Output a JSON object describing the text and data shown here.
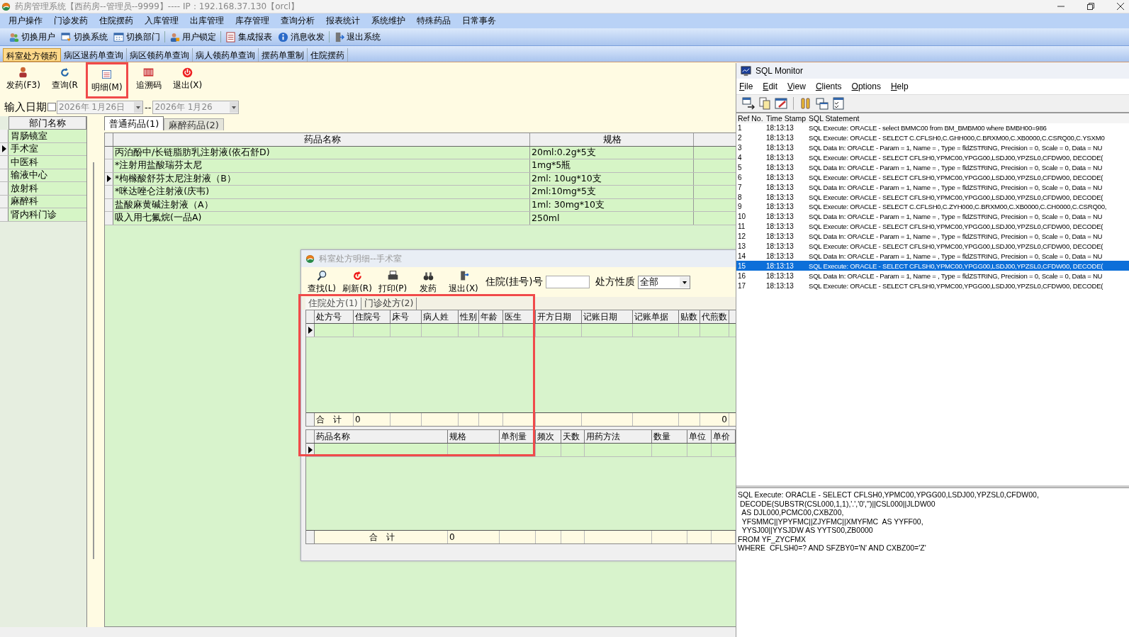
{
  "main_window": {
    "title": "药房管理系统【西药房--管理员--9999】---- IP：192.168.37.130【orcl】",
    "menu": [
      "用户操作",
      "门诊发药",
      "住院摆药",
      "入库管理",
      "出库管理",
      "库存管理",
      "查询分析",
      "报表统计",
      "系统维护",
      "特殊药品",
      "日常事务"
    ],
    "toolbar": [
      "切换用户",
      "切换系统",
      "切换部门",
      "用户锁定",
      "集成报表",
      "消息收发",
      "退出系统"
    ],
    "tabs": [
      {
        "label": "科室处方领药",
        "selected": true
      },
      {
        "label": "病区退药单查询",
        "selected": false
      },
      {
        "label": "病区领药单查询",
        "selected": false
      },
      {
        "label": "病人领药单查询",
        "selected": false
      },
      {
        "label": "摆药单重制",
        "selected": false
      },
      {
        "label": "住院摆药",
        "selected": false
      }
    ],
    "actions": [
      "发药(F3)",
      "查询(R",
      "明细(M)",
      "追溯码",
      "退出(X)"
    ],
    "date_filter": {
      "label": "输入日期",
      "checked": false,
      "from": "2026年 1月26日",
      "separator": "--",
      "to": "2026年 1月26"
    },
    "departments": {
      "header": "部门名称",
      "items": [
        {
          "name": "胃肠镜室",
          "selected": false
        },
        {
          "name": "手术室",
          "selected": true
        },
        {
          "name": "中医科",
          "selected": false
        },
        {
          "name": "输液中心",
          "selected": false
        },
        {
          "name": "放射科",
          "selected": false
        },
        {
          "name": "麻醉科",
          "selected": false
        },
        {
          "name": "肾内科门诊",
          "selected": false
        }
      ]
    },
    "drug_tabs": [
      {
        "label": "普通药品(1)",
        "selected": true
      },
      {
        "label": "麻醉药品(2)",
        "selected": false
      }
    ],
    "drug_table": {
      "columns": [
        "药品名称",
        "规格"
      ],
      "rows": [
        {
          "name": "丙泊酚中/长链脂肪乳注射液(依石舒D)",
          "spec": "20ml:0.2g*5支",
          "selected": false
        },
        {
          "name": "*注射用盐酸瑞芬太尼",
          "spec": "1mg*5瓶",
          "selected": false
        },
        {
          "name": "*枸橼酸舒芬太尼注射液（B）",
          "spec": "2ml: 10ug*10支",
          "selected": true
        },
        {
          "name": "*咪达唑仑注射液(庆韦)",
          "spec": "2ml:10mg*5支",
          "selected": false
        },
        {
          "name": "盐酸麻黄碱注射液（A）",
          "spec": "1ml: 30mg*10支",
          "selected": false
        },
        {
          "name": "吸入用七氟烷(一品A)",
          "spec": "250ml",
          "selected": false
        }
      ]
    }
  },
  "detail_dialog": {
    "title": "科室处方明细--手术室",
    "toolbar": [
      "查找(L)",
      "刷新(R)",
      "打印(P)",
      "发药",
      "退出(X)"
    ],
    "inpatient_no_label": "住院(挂号)号",
    "type_label": "处方性质",
    "type_value": "全部",
    "tabs": [
      {
        "label": "住院处方(1)",
        "selected": true
      },
      {
        "label": "门诊处方(2)",
        "selected": false
      }
    ],
    "prescription_table": {
      "columns": [
        "处方号",
        "住院号",
        "床号",
        "病人姓",
        "性别",
        "年龄",
        "医生",
        "开方日期",
        "记账日期",
        "记账单据",
        "贴数",
        "代煎数"
      ],
      "total_label": "合　计",
      "total_count": "0",
      "total_amount": "0"
    },
    "drug_table": {
      "columns": [
        "药品名称",
        "规格",
        "单剂量",
        "频次",
        "天数",
        "用药方法",
        "数量",
        "单位",
        "单价"
      ],
      "total_label": "合　计",
      "total": "0"
    }
  },
  "sql_monitor": {
    "title": "SQL Monitor",
    "menu": [
      "File",
      "Edit",
      "View",
      "Clients",
      "Options",
      "Help"
    ],
    "columns": [
      "Ref No.",
      "Time Stamp",
      "SQL Statement"
    ],
    "rows": [
      {
        "ref": "1",
        "time": "18:13:13",
        "statement": "SQL Execute: ORACLE - select BMMC00 from BM_BMBM00 where BMBH00=986",
        "selected": false
      },
      {
        "ref": "2",
        "time": "18:13:13",
        "statement": "SQL Execute: ORACLE - SELECT C.CFLSH0,C.GHH000,C.BRXM00,C.XB0000,C.CSRQ00,C.YSXM0",
        "selected": false
      },
      {
        "ref": "3",
        "time": "18:13:13",
        "statement": "SQL Data In: ORACLE - Param = 1, Name = , Type = fldZSTRING, Precision = 0, Scale = 0, Data = NU",
        "selected": false
      },
      {
        "ref": "4",
        "time": "18:13:13",
        "statement": "SQL Execute: ORACLE - SELECT CFLSH0,YPMC00,YPGG00,LSDJ00,YPZSL0,CFDW00,  DECODE(",
        "selected": false
      },
      {
        "ref": "5",
        "time": "18:13:13",
        "statement": "SQL Data In: ORACLE - Param = 1, Name = , Type = fldZSTRING, Precision = 0, Scale = 0, Data = NU",
        "selected": false
      },
      {
        "ref": "6",
        "time": "18:13:13",
        "statement": "SQL Execute: ORACLE - SELECT CFLSH0,YPMC00,YPGG00,LSDJ00,YPZSL0,CFDW00,  DECODE(",
        "selected": false
      },
      {
        "ref": "7",
        "time": "18:13:13",
        "statement": "SQL Data In: ORACLE - Param = 1, Name = , Type = fldZSTRING, Precision = 0, Scale = 0, Data = NU",
        "selected": false
      },
      {
        "ref": "8",
        "time": "18:13:13",
        "statement": "SQL Execute: ORACLE - SELECT CFLSH0,YPMC00,YPGG00,LSDJ00,YPZSL0,CFDW00,  DECODE(",
        "selected": false
      },
      {
        "ref": "9",
        "time": "18:13:13",
        "statement": "SQL Execute: ORACLE - SELECT C.CFLSH0,C.ZYH000,C.BRXM00,C.XB0000,C.CH0000,C.CSRQ00,",
        "selected": false
      },
      {
        "ref": "10",
        "time": "18:13:13",
        "statement": "SQL Data In: ORACLE - Param = 1, Name = , Type = fldZSTRING, Precision = 0, Scale = 0, Data = NU",
        "selected": false
      },
      {
        "ref": "11",
        "time": "18:13:13",
        "statement": "SQL Execute: ORACLE - SELECT CFLSH0,YPMC00,YPGG00,LSDJ00,YPZSL0,CFDW00,  DECODE(",
        "selected": false
      },
      {
        "ref": "12",
        "time": "18:13:13",
        "statement": "SQL Data In: ORACLE - Param = 1, Name = , Type = fldZSTRING, Precision = 0, Scale = 0, Data = NU",
        "selected": false
      },
      {
        "ref": "13",
        "time": "18:13:13",
        "statement": "SQL Execute: ORACLE - SELECT CFLSH0,YPMC00,YPGG00,LSDJ00,YPZSL0,CFDW00,  DECODE(",
        "selected": false
      },
      {
        "ref": "14",
        "time": "18:13:13",
        "statement": "SQL Data In: ORACLE - Param = 1, Name = , Type = fldZSTRING, Precision = 0, Scale = 0, Data = NU",
        "selected": false
      },
      {
        "ref": "15",
        "time": "18:13:13",
        "statement": "SQL Execute: ORACLE - SELECT CFLSH0,YPMC00,YPGG00,LSDJ00,YPZSL0,CFDW00,  DECODE(",
        "selected": true
      },
      {
        "ref": "16",
        "time": "18:13:13",
        "statement": "SQL Data In: ORACLE - Param = 1, Name = , Type = fldZSTRING, Precision = 0, Scale = 0, Data = NU",
        "selected": false
      },
      {
        "ref": "17",
        "time": "18:13:13",
        "statement": "SQL Execute: ORACLE - SELECT CFLSH0,YPMC00,YPGG00,LSDJ00,YPZSL0,CFDW00,  DECODE(",
        "selected": false
      }
    ],
    "detail_lines": [
      "SQL Execute: ORACLE - SELECT CFLSH0,YPMC00,YPGG00,LSDJ00,YPZSL0,CFDW00,",
      " DECODE(SUBSTR(CSL000,1,1),'.','0','')||CSL000||JLDW00",
      "  AS DJL000,PCMC00,CXBZ00,",
      "  YFSMMC||YPYFMC||ZJYFMC||XMYFMC  AS YYFF00,",
      "  YYSJ00||YYSJDW AS YYTS00,ZB0000",
      "FROM YF_ZYCFMX",
      "WHERE  CFLSH0=? AND SFZBY0='N' AND CXBZ00='Z'"
    ]
  }
}
